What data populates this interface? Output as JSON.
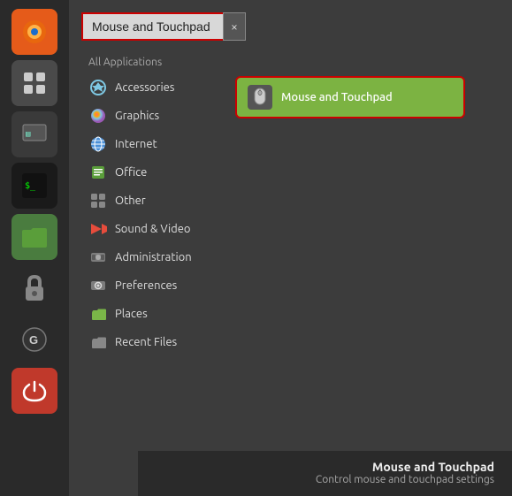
{
  "sidebar": {
    "icons": [
      {
        "name": "firefox-icon",
        "label": "Firefox",
        "class": "icon-firefox",
        "glyph": "🦊"
      },
      {
        "name": "grid-icon",
        "label": "App Grid",
        "class": "icon-grid",
        "glyph": "⠿"
      },
      {
        "name": "guake-icon",
        "label": "Guake",
        "class": "icon-guake",
        "glyph": "▦"
      },
      {
        "name": "terminal-icon",
        "label": "Terminal",
        "class": "icon-term",
        "glyph": ">_"
      },
      {
        "name": "folder-icon",
        "label": "Files",
        "class": "icon-folder",
        "glyph": "📁"
      },
      {
        "name": "lock-icon",
        "label": "Lock",
        "class": "icon-lock",
        "glyph": "🔒"
      },
      {
        "name": "grub-icon",
        "label": "Grub",
        "class": "icon-grub",
        "glyph": "G"
      },
      {
        "name": "power-icon",
        "label": "Power",
        "class": "icon-power",
        "glyph": "⏻"
      }
    ]
  },
  "search": {
    "value": "Mouse and Touchpad",
    "clear_label": "×"
  },
  "categories": {
    "header": "All Applications",
    "items": [
      {
        "name": "accessories",
        "label": "Accessories",
        "icon_type": "accessories"
      },
      {
        "name": "graphics",
        "label": "Graphics",
        "icon_type": "graphics"
      },
      {
        "name": "internet",
        "label": "Internet",
        "icon_type": "internet"
      },
      {
        "name": "office",
        "label": "Office",
        "icon_type": "office"
      },
      {
        "name": "other",
        "label": "Other",
        "icon_type": "other"
      },
      {
        "name": "sound-video",
        "label": "Sound & Video",
        "icon_type": "sound"
      },
      {
        "name": "administration",
        "label": "Administration",
        "icon_type": "admin"
      },
      {
        "name": "preferences",
        "label": "Preferences",
        "icon_type": "preferences"
      },
      {
        "name": "places",
        "label": "Places",
        "icon_type": "places"
      },
      {
        "name": "recent-files",
        "label": "Recent Files",
        "icon_type": "recent"
      }
    ]
  },
  "results": [
    {
      "name": "mouse-touchpad",
      "label": "Mouse and Touchpad",
      "icon_type": "mouse"
    }
  ],
  "bottom": {
    "title": "Mouse and Touchpad",
    "description": "Control mouse and touchpad settings"
  }
}
